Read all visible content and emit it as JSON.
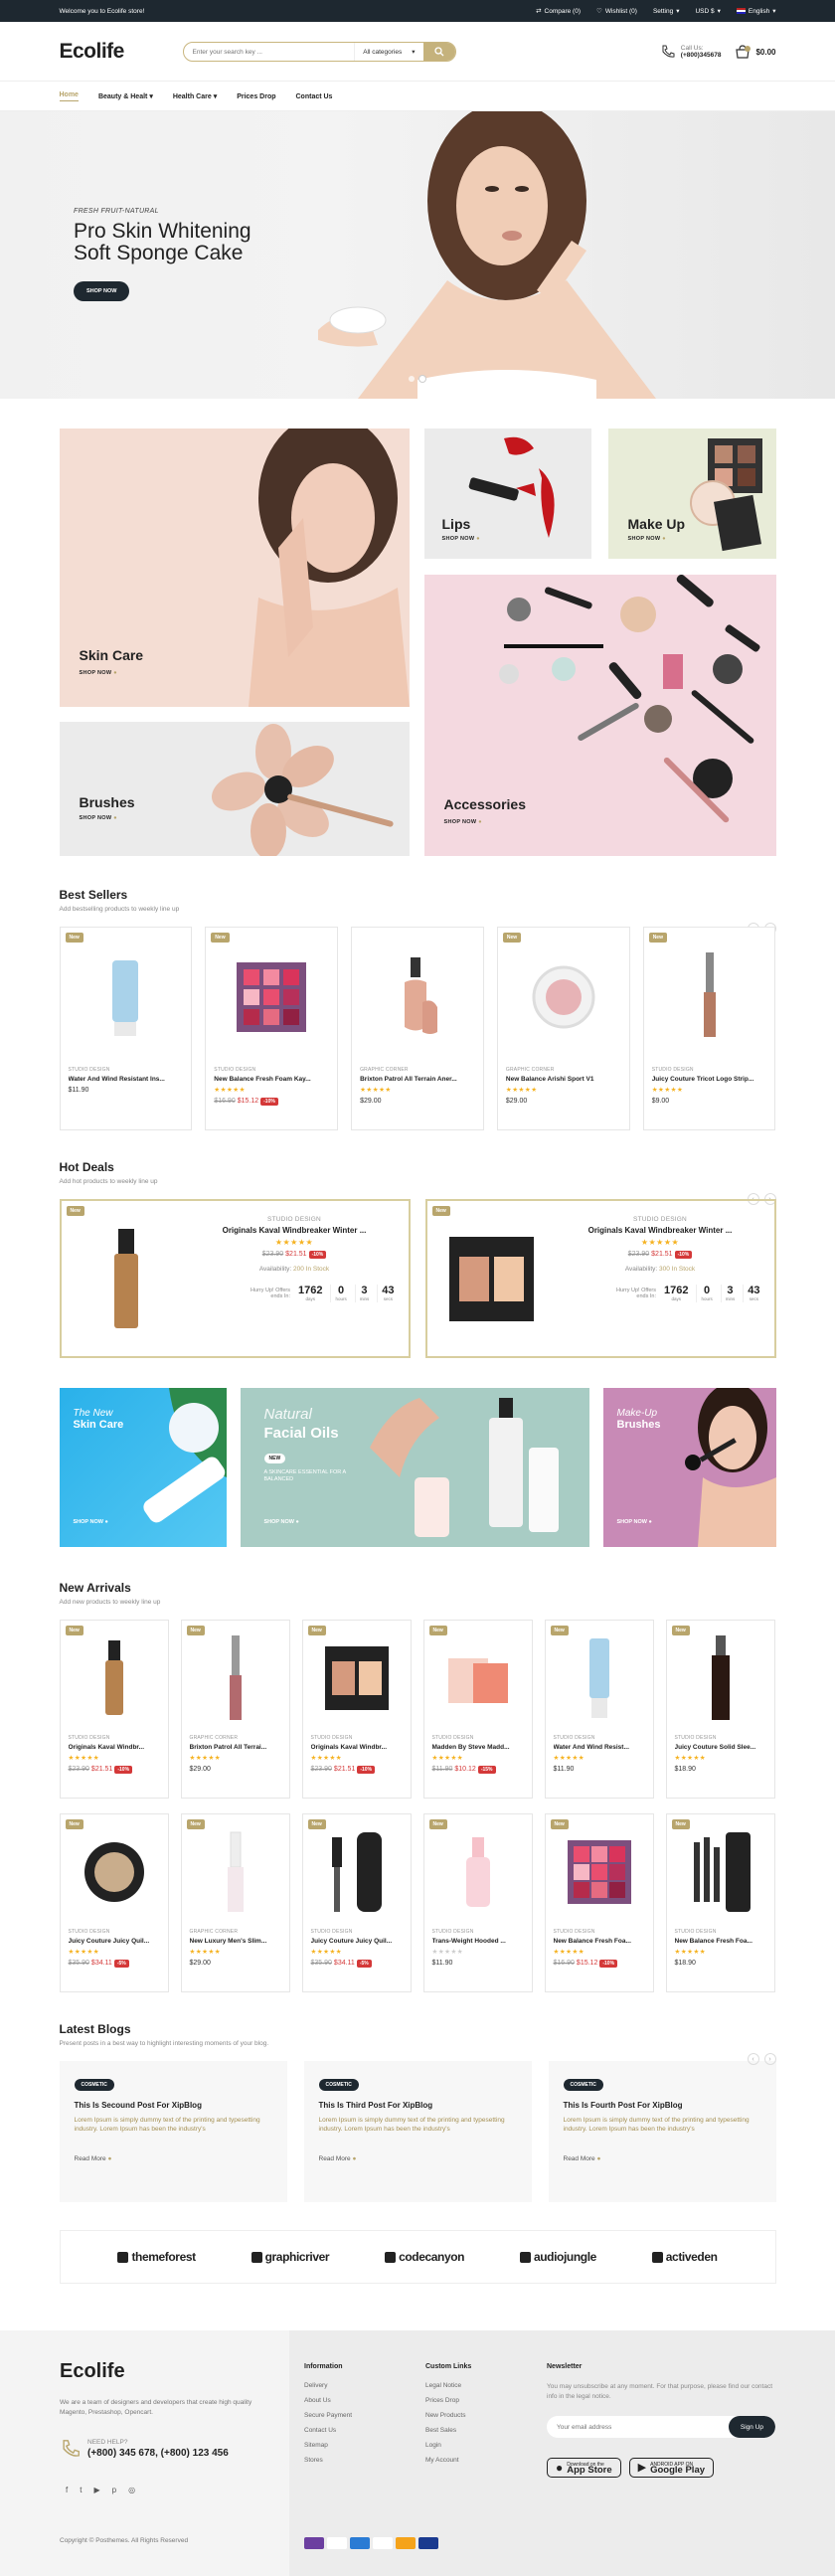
{
  "topbar": {
    "welcome": "Welcome you to Ecolife store!",
    "compare": "Compare (0)",
    "wishlist": "Wishlist (0)",
    "setting": "Setting",
    "currency": "USD $",
    "language": "English"
  },
  "header": {
    "logo": "Ecolife",
    "search_placeholder": "Enter your search key ...",
    "category": "All categories",
    "call_label": "Call Us:",
    "phone": "(+800)345678",
    "cart_total": "$0.00"
  },
  "nav": [
    "Home",
    "Beauty & Healt",
    "Health Care",
    "Prices Drop",
    "Contact Us"
  ],
  "hero": {
    "subtitle": "FRESH FRUIT-NATURAL",
    "title_line1": "Pro Skin Whitening",
    "title_line2": "Soft Sponge Cake",
    "button": "SHOP NOW"
  },
  "banners": {
    "skin_care": "Skin Care",
    "lips": "Lips",
    "make_up": "Make Up",
    "brushes": "Brushes",
    "accessories": "Accessories",
    "shop_now": "SHOP NOW"
  },
  "best_sellers": {
    "title": "Best Sellers",
    "subtitle": "Add bestselling products to weekly line up",
    "items": [
      {
        "badge": "New",
        "cat": "STUDIO DESIGN",
        "name": "Water And Wind Resistant Ins...",
        "old": "",
        "price": "$11.90",
        "off": "",
        "stars": ""
      },
      {
        "badge": "New",
        "cat": "STUDIO DESIGN",
        "name": "New Balance Fresh Foam Kay...",
        "old": "$16.90",
        "price": "$15.12",
        "off": "-10%",
        "stars": "★★★★★"
      },
      {
        "badge": "",
        "cat": "GRAPHIC CORNER",
        "name": "Brixton Patrol All Terrain Aner...",
        "old": "",
        "price": "$29.00",
        "off": "",
        "stars": "★★★★★"
      },
      {
        "badge": "New",
        "cat": "GRAPHIC CORNER",
        "name": "New Balance Arishi Sport V1",
        "old": "",
        "price": "$29.00",
        "off": "",
        "stars": "★★★★★"
      },
      {
        "badge": "New",
        "cat": "STUDIO DESIGN",
        "name": "Juicy Couture Tricot Logo Strip...",
        "old": "",
        "price": "$9.00",
        "off": "",
        "stars": "★★★★★"
      }
    ]
  },
  "hot_deals": {
    "title": "Hot Deals",
    "subtitle": "Add hot products to weekly line up",
    "items": [
      {
        "badge": "New",
        "cat": "STUDIO DESIGN",
        "name": "Originals Kaval Windbreaker Winter ...",
        "old": "$23.90",
        "price": "$21.51",
        "off": "-10%",
        "avail_label": "Availability:",
        "avail": "200 In Stock",
        "hurry": "Hurry Up! Offers ends In:",
        "days": "1762",
        "hours": "0",
        "mins": "3",
        "secs": "43"
      },
      {
        "badge": "New",
        "cat": "STUDIO DESIGN",
        "name": "Originals Kaval Windbreaker Winter ...",
        "old": "$23.90",
        "price": "$21.51",
        "off": "-10%",
        "avail_label": "Availability:",
        "avail": "300 In Stock",
        "hurry": "Hurry Up! Offers ends In:",
        "days": "1762",
        "hours": "0",
        "mins": "3",
        "secs": "43"
      }
    ],
    "labels": {
      "days": "days",
      "hours": "hours",
      "mins": "mins",
      "secs": "secs"
    }
  },
  "promos": {
    "p1": {
      "l1": "The New",
      "l2": "Skin Care",
      "btn": "SHOP NOW"
    },
    "p2": {
      "l1": "Natural",
      "l2": "Facial Oils",
      "tag": "NEW",
      "desc": "A SKINCARE ESSENTIAL FOR A BALANCED",
      "btn": "SHOP NOW"
    },
    "p3": {
      "l1": "Make-Up",
      "l2": "Brushes",
      "btn": "SHOP NOW"
    }
  },
  "new_arrivals": {
    "title": "New Arrivals",
    "subtitle": "Add new products to weekly line up",
    "items": [
      {
        "badge": "New",
        "cat": "STUDIO DESIGN",
        "name": "Originals Kaval Windbr...",
        "old": "$23.90",
        "price": "$21.51",
        "off": "-10%",
        "stars": "★★★★★"
      },
      {
        "badge": "New",
        "cat": "GRAPHIC CORNER",
        "name": "Brixton Patrol All Terrai...",
        "old": "",
        "price": "$29.00",
        "off": "",
        "stars": "★★★★★"
      },
      {
        "badge": "New",
        "cat": "STUDIO DESIGN",
        "name": "Originals Kaval Windbr...",
        "old": "$23.90",
        "price": "$21.51",
        "off": "-10%",
        "stars": "★★★★★"
      },
      {
        "badge": "New",
        "cat": "STUDIO DESIGN",
        "name": "Madden By Steve Madd...",
        "old": "$11.90",
        "price": "$10.12",
        "off": "-15%",
        "stars": "★★★★★"
      },
      {
        "badge": "New",
        "cat": "STUDIO DESIGN",
        "name": "Water And Wind Resist...",
        "old": "",
        "price": "$11.90",
        "off": "",
        "stars": "★★★★★"
      },
      {
        "badge": "New",
        "cat": "STUDIO DESIGN",
        "name": "Juicy Couture Solid Slee...",
        "old": "",
        "price": "$18.90",
        "off": "",
        "stars": "★★★★★"
      },
      {
        "badge": "New",
        "cat": "STUDIO DESIGN",
        "name": "Juicy Couture Juicy Quil...",
        "old": "$35.90",
        "price": "$34.11",
        "off": "-5%",
        "stars": "★★★★★"
      },
      {
        "badge": "New",
        "cat": "GRAPHIC CORNER",
        "name": "New Luxury Men's Slim...",
        "old": "",
        "price": "$29.00",
        "off": "",
        "stars": "★★★★★"
      },
      {
        "badge": "New",
        "cat": "STUDIO DESIGN",
        "name": "Juicy Couture Juicy Quil...",
        "old": "$35.90",
        "price": "$34.11",
        "off": "-5%",
        "stars": "★★★★★"
      },
      {
        "badge": "New",
        "cat": "STUDIO DESIGN",
        "name": "Trans-Weight Hooded ...",
        "old": "",
        "price": "$11.90",
        "off": "",
        "stars": "★★★★★"
      },
      {
        "badge": "New",
        "cat": "STUDIO DESIGN",
        "name": "New Balance Fresh Foa...",
        "old": "$16.90",
        "price": "$15.12",
        "off": "-10%",
        "stars": "★★★★★"
      },
      {
        "badge": "New",
        "cat": "STUDIO DESIGN",
        "name": "New Balance Fresh Foa...",
        "old": "",
        "price": "$18.90",
        "off": "",
        "stars": "★★★★★"
      }
    ]
  },
  "blogs": {
    "title": "Latest Blogs",
    "subtitle": "Present posts in a best way to highlight interesting moments of your blog.",
    "items": [
      {
        "tag": "COSMETIC",
        "title": "This Is Secound Post For XipBlog",
        "text": "Lorem Ipsum is simply dummy text of the printing and typesetting industry. Lorem Ipsum has been the industry's",
        "more": "Read More"
      },
      {
        "tag": "COSMETIC",
        "title": "This Is Third Post For XipBlog",
        "text": "Lorem Ipsum is simply dummy text of the printing and typesetting industry. Lorem Ipsum has been the industry's",
        "more": "Read More"
      },
      {
        "tag": "COSMETIC",
        "title": "This Is Fourth Post For XipBlog",
        "text": "Lorem Ipsum is simply dummy text of the printing and typesetting industry. Lorem Ipsum has been the industry's",
        "more": "Read More"
      }
    ]
  },
  "brands": [
    "themeforest",
    "graphicriver",
    "codecanyon",
    "audiojungle",
    "activeden"
  ],
  "footer": {
    "logo": "Ecolife",
    "about": "We are a team of designers and developers that create high quality Magento, Prestashop, Opencart.",
    "help": "NEED HELP?",
    "phones": "(+800) 345 678, (+800) 123 456",
    "copyright": "Copyright © Posthemes. All Rights Reserved",
    "info_title": "Information",
    "info": [
      "Delivery",
      "About Us",
      "Secure Payment",
      "Contact Us",
      "Sitemap",
      "Stores"
    ],
    "custom_title": "Custom Links",
    "custom": [
      "Legal Notice",
      "Prices Drop",
      "New Products",
      "Best Sales",
      "Login",
      "My Account"
    ],
    "news_title": "Newsletter",
    "news_text": "You may unsubscribe at any moment. For that purpose, please find our contact info in the legal notice.",
    "email_placeholder": "Your email address",
    "signup": "Sign Up",
    "appstore_small": "Download on the",
    "appstore": "App Store",
    "google_small": "ANDROID APP ON",
    "google": "Google Play"
  },
  "colors": {
    "accent": "#b8a56c",
    "dark": "#1e2830",
    "sale": "#d43838"
  }
}
